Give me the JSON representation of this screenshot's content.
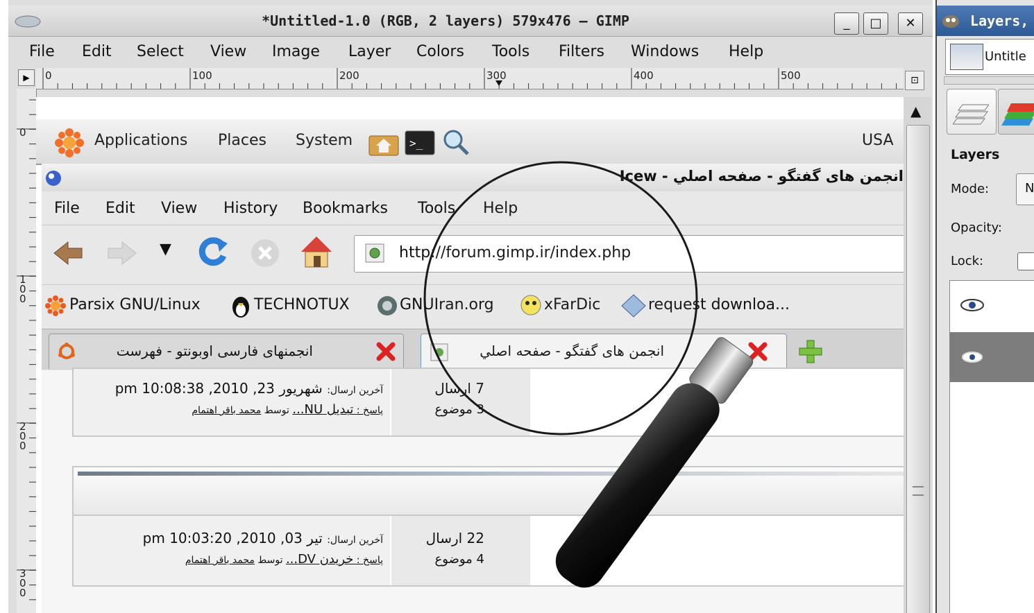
{
  "gimp": {
    "title": "*Untitled-1.0 (RGB, 2 layers) 579x476 – GIMP",
    "menu": [
      "File",
      "Edit",
      "Select",
      "View",
      "Image",
      "Layer",
      "Colors",
      "Tools",
      "Filters",
      "Windows",
      "Help"
    ],
    "hruler_labels": [
      "0",
      "100",
      "200",
      "300",
      "400",
      "500"
    ],
    "vruler_labels": [
      "0",
      "1\n0\n0",
      "2\n0\n0",
      "3\n0\n0"
    ],
    "win_buttons": [
      "_",
      "□",
      "✕"
    ]
  },
  "canvas_content": {
    "panel": {
      "items": [
        "Applications",
        "Places",
        "System"
      ],
      "right_text": "USA"
    },
    "firefox": {
      "title": "Icew - انجمن های گفتگو - صفحه اصلي",
      "menu": [
        "File",
        "Edit",
        "View",
        "History",
        "Bookmarks",
        "Tools",
        "Help"
      ],
      "url": "http://forum.gimp.ir/index.php",
      "bookmarks": [
        "Parsix GNU/Linux",
        "TECHNOTUX",
        "GNUIran.org",
        "xFarDic",
        "request downloa..."
      ],
      "tabs": [
        {
          "label": "انجمنهای فارسی اوبونتو - فهرست"
        },
        {
          "label": "انجمن های گفتگو - صفحه اصلي"
        }
      ],
      "rows": [
        {
          "last_post_prefix": "آخرین ارسال:",
          "last_post_date": "شهریور 23, 2010, 10:08:38 pm",
          "reply_prefix": "پاسخ :",
          "reply_link": "تبدیل NU...",
          "by": "توسط",
          "author": "محمد باقر اهتمام",
          "posts": "7 ارسال",
          "topics": "3 موضوع"
        },
        {
          "last_post_prefix": "آخرین ارسال:",
          "last_post_date": "تیر 03, 2010, 10:03:20 pm",
          "reply_prefix": "پاسخ :",
          "reply_link": "خریدن DV...",
          "by": "توسط",
          "author": "محمد باقر اهتمام",
          "posts": "22 ارسال",
          "topics": "4 موضوع"
        }
      ]
    }
  },
  "dock": {
    "title": "Layers,",
    "image_label": "Untitle",
    "section": "Layers",
    "mode_label": "Mode:",
    "mode_value": "N",
    "opacity_label": "Opacity:",
    "lock_label": "Lock:"
  }
}
